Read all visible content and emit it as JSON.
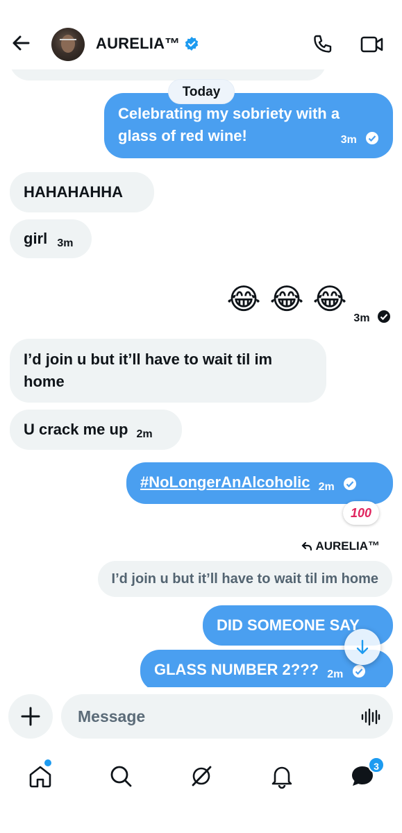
{
  "header": {
    "title": "AURELIA™"
  },
  "chat": {
    "date_divider": "Today",
    "messages": [
      {
        "text": "Celebrating my sobriety with a glass of red wine!",
        "time": "3m",
        "direction": "out"
      },
      {
        "text": "HAHAHAHHA",
        "time": "",
        "direction": "in"
      },
      {
        "text": "girl",
        "time": "3m",
        "direction": "in"
      },
      {
        "text": "😂 😂 😂",
        "time": "3m",
        "direction": "out"
      },
      {
        "text": "I’d join u but it’ll have to wait til im home",
        "time": "",
        "direction": "in"
      },
      {
        "text": "U crack me up",
        "time": "2m",
        "direction": "in"
      },
      {
        "text": "#NoLongerAnAlcoholic",
        "time": "2m",
        "direction": "out",
        "reaction": "💯"
      },
      {
        "reply_to": "AURELIA™",
        "quoted": "I’d join u but it’ll have to wait til im home"
      },
      {
        "text": "DID SOMEONE SAY",
        "time": "",
        "direction": "out"
      },
      {
        "text": "GLASS NUMBER 2???",
        "time": "2m",
        "direction": "out"
      }
    ],
    "reaction_label": "100"
  },
  "composer": {
    "placeholder": "Message"
  },
  "nav": {
    "messages_badge": "3"
  },
  "colors": {
    "outgoing_bubble": "#4a9ff0",
    "incoming_bubble": "#eff3f4",
    "accent": "#1d9bf0"
  },
  "icons": [
    "back-arrow-icon",
    "verified-icon",
    "phone-icon",
    "video-icon",
    "plus-icon",
    "voice-icon",
    "home-icon",
    "search-icon",
    "grok-icon",
    "bell-icon",
    "messages-icon",
    "arrow-down-icon",
    "reply-arrow-icon",
    "check-circle-icon"
  ]
}
